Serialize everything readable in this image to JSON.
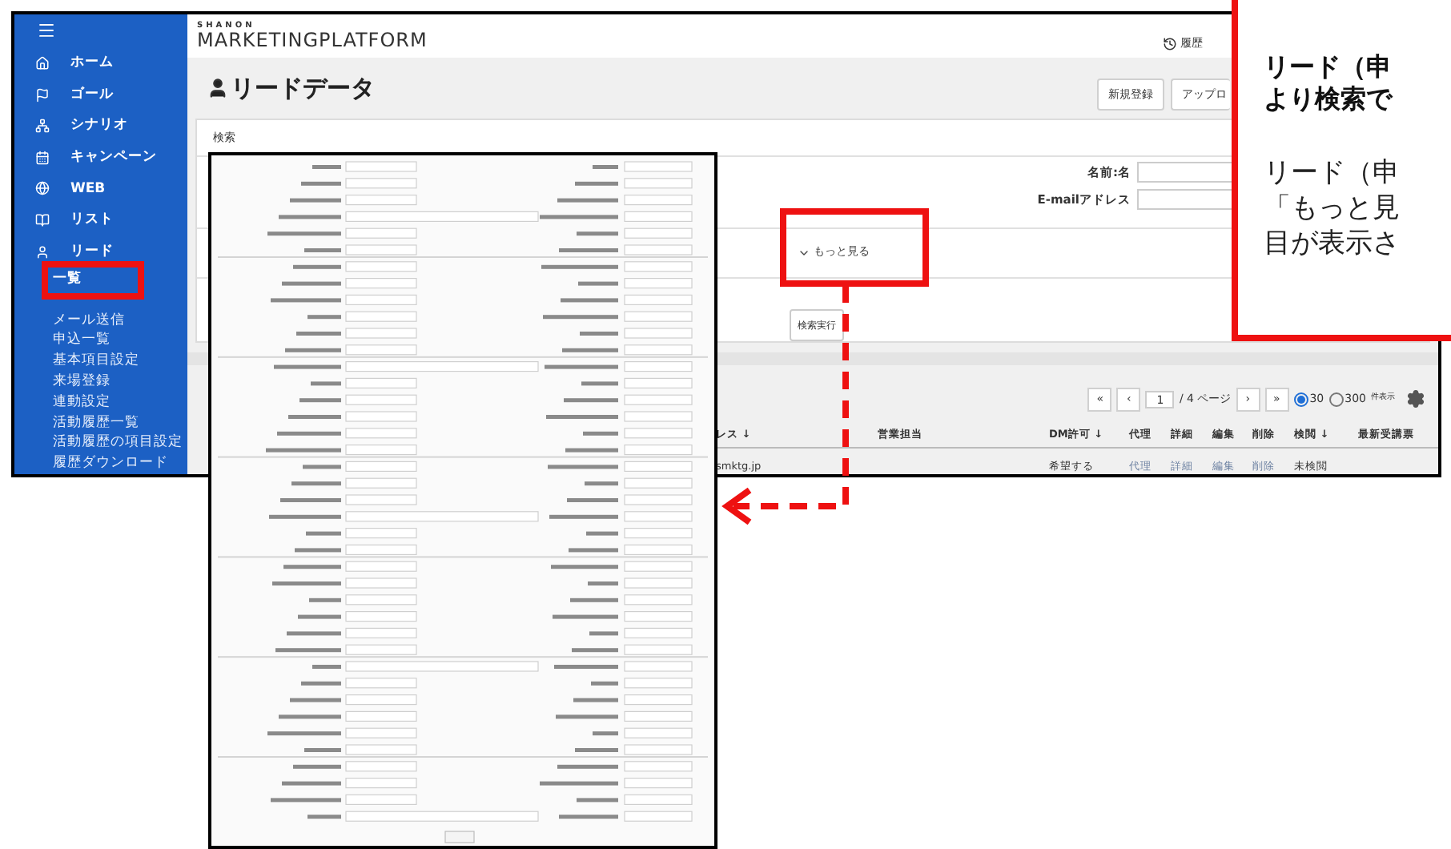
{
  "app": {
    "brand_top": "SHANON",
    "brand": "MARKETINGPLATFORM",
    "history": "履歴"
  },
  "sidebar": {
    "items": [
      {
        "label": "ホーム"
      },
      {
        "label": "ゴール"
      },
      {
        "label": "シナリオ"
      },
      {
        "label": "キャンペーン"
      },
      {
        "label": "WEB"
      },
      {
        "label": "リスト"
      },
      {
        "label": "リード"
      }
    ],
    "subitems": [
      {
        "label": "一覧",
        "selected": true
      },
      {
        "label": "メール送信",
        "selected": false
      },
      {
        "label": "申込一覧",
        "selected": false
      },
      {
        "label": "基本項目設定",
        "selected": false
      },
      {
        "label": "来場登録",
        "selected": false
      },
      {
        "label": "連動設定",
        "selected": false
      },
      {
        "label": "活動履歴一覧",
        "selected": false
      },
      {
        "label": "活動履歴の項目設定",
        "selected": false
      },
      {
        "label": "履歴ダウンロード",
        "selected": false
      }
    ]
  },
  "page": {
    "title": "リードデータ",
    "buttons": [
      "新規登録",
      "アップロ"
    ]
  },
  "search": {
    "title": "検索",
    "fields": [
      {
        "label": "名前:名"
      },
      {
        "label": "E-mailアドレス"
      }
    ],
    "more": "もっと見る",
    "submit": "検索実行"
  },
  "pagination": {
    "first": "«",
    "prev": "‹",
    "page": "1",
    "total": "/ 4 ページ",
    "next": "›",
    "last": "»",
    "sizes": [
      {
        "label": "30",
        "selected": true
      },
      {
        "label": "300",
        "selected": false
      }
    ],
    "suffix": "件表示"
  },
  "table": {
    "columns": [
      "レス ↓",
      "営業担当",
      "DM許可 ↓",
      "代理",
      "詳細",
      "編集",
      "削除",
      "検閲 ↓",
      "最新受講票"
    ],
    "rows": [
      {
        "cells": [
          {
            "text": "smktg.jp",
            "link": false
          },
          null,
          {
            "text": "希望する",
            "link": false
          },
          {
            "text": "代理",
            "link": true
          },
          {
            "text": "詳細",
            "link": true
          },
          {
            "text": "編集",
            "link": true
          },
          {
            "text": "削除",
            "link": true
          },
          {
            "text": "未検閲",
            "link": false
          },
          null
        ]
      }
    ]
  },
  "callout": {
    "heading": [
      "リード（申",
      "より検索で"
    ],
    "body": [
      "リード（申",
      "「もっと見",
      "目が表示さ"
    ]
  }
}
